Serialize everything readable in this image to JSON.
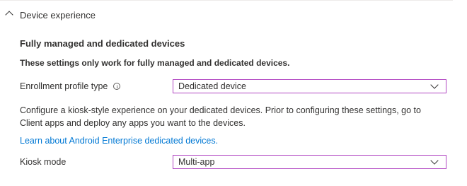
{
  "section": {
    "title": "Device experience",
    "expanded": true
  },
  "heading": "Fully managed and dedicated devices",
  "note": "These settings only work for fully managed and dedicated devices.",
  "enrollment": {
    "label": "Enrollment profile type",
    "value": "Dedicated device"
  },
  "description": "Configure a kiosk-style experience on your dedicated devices. Prior to configuring these settings, go to Client apps and deploy any apps you want to the devices.",
  "learn_link": "Learn about Android Enterprise dedicated devices.",
  "kiosk": {
    "label": "Kiosk mode",
    "value": "Multi-app"
  },
  "colors": {
    "link": "#0078d4",
    "dropdown_border": "#b146c2",
    "text": "#323130"
  },
  "icons": {
    "collapse": "chevron-up-icon",
    "info": "info-icon",
    "dropdown": "chevron-down-icon"
  }
}
